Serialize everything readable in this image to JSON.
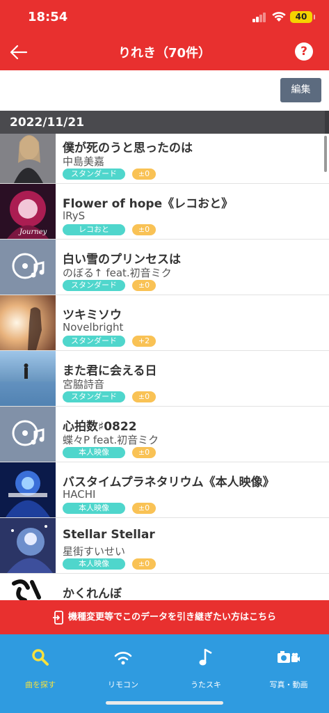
{
  "status": {
    "time": "18:54",
    "battery": "40"
  },
  "header": {
    "title": "りれき（70件）",
    "help": "?"
  },
  "toolbar": {
    "edit_label": "編集"
  },
  "date_band": "2022/11/21",
  "rows": [
    {
      "title": "僕が死のうと思ったのは",
      "artist": "中島美嘉",
      "tag": "スタンダード",
      "score": "±0"
    },
    {
      "title": "Flower of hope《レコおと》",
      "artist": "lRyS",
      "tag": "レコおと",
      "score": "±0"
    },
    {
      "title": "白い雪のプリンセスは",
      "artist": "のぼる↑ feat.初音ミク",
      "tag": "スタンダード",
      "score": "±0"
    },
    {
      "title": "ツキミソウ",
      "artist": "Novelbright",
      "tag": "スタンダード",
      "score": "+2"
    },
    {
      "title": "また君に会える日",
      "artist": "宮脇詩音",
      "tag": "スタンダード",
      "score": "±0"
    },
    {
      "title": "心拍数♯0822",
      "artist": "蝶々P feat.初音ミク",
      "tag": "本人映像",
      "score": "±0"
    },
    {
      "title": "バスタイムプラネタリウム《本人映像》",
      "artist": "HACHI",
      "tag": "本人映像",
      "score": "±0"
    },
    {
      "title": "Stellar Stellar",
      "artist": "星街すいせい",
      "tag": "本人映像",
      "score": "±0"
    },
    {
      "title": "かくれんぼ",
      "artist": "",
      "tag": "",
      "score": ""
    }
  ],
  "banner": {
    "text": "機種変更等でこのデータを引き継ぎたい方はこちら"
  },
  "tabs": [
    {
      "label": "曲を探す",
      "icon": "search-icon",
      "active": true
    },
    {
      "label": "リモコン",
      "icon": "wifi-icon",
      "active": false
    },
    {
      "label": "うたスキ",
      "icon": "music-note-icon",
      "active": false
    },
    {
      "label": "写真・動画",
      "icon": "camera-icon",
      "active": false
    }
  ],
  "colors": {
    "brand_red": "#e8302f",
    "tab_blue": "#2f9be0",
    "tag_teal": "#4fd6cc",
    "score_orange": "#f9c255",
    "active_yellow": "#f6e13e"
  }
}
